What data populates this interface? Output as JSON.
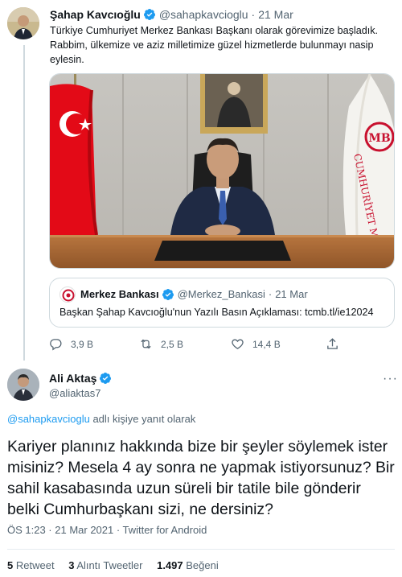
{
  "tweet1": {
    "author_name": "Şahap Kavcıoğlu",
    "handle": "@sahapkavcioglu",
    "separator": "·",
    "date": "21 Mar",
    "text_line1": "Türkiye Cumhuriyet Merkez Bankası Başkanı olarak görevimize başladık.",
    "text_line2": "Rabbim, ülkemize ve aziz milletimize güzel hizmetlerde bulunmayı nasip",
    "text_line3": "eylesin.",
    "photo_banner_text": "CUMHURİYET MERKEZ BANKASI",
    "photo_logo_text": "MB",
    "quote": {
      "author_name": "Merkez Bankası",
      "handle": "@Merkez_Bankasi",
      "separator": "·",
      "date": "21 Mar",
      "text": "Başkan Şahap Kavcıoğlu'nun Yazılı Basın Açıklaması: tcmb.tl/ie12024"
    },
    "actions": {
      "reply_count": "3,9 B",
      "retweet_count": "2,5 B",
      "like_count": "14,4 B"
    }
  },
  "tweet2": {
    "author_name": "Ali Aktaş",
    "handle": "@aliaktas7",
    "more_label": "···",
    "reply_to_handle": "@sahapkavcioglu",
    "reply_to_suffix": " adlı kişiye yanıt olarak",
    "text_line1": "Kariyer planınız hakkında bize bir şeyler söylemek ister",
    "text_line2": "misiniz? Mesela 4 ay sonra ne yapmak istiyorsunuz? Bir",
    "text_line3": "sahil kasabasında uzun süreli bir tatile bile gönderir",
    "text_line4": "belki Cumhurbaşkanı sizi, ne dersiniz?",
    "meta": "ÖS 1:23 · 21 Mar 2021 · Twitter for Android",
    "stats": {
      "retweets_count": "5",
      "retweets_label": "Retweet",
      "quotes_count": "3",
      "quotes_label": "Alıntı Tweetler",
      "likes_count": "1.497",
      "likes_label": "Beğeni"
    }
  },
  "colors": {
    "accent": "#1d9bf0",
    "muted": "#536471",
    "text": "#0f1419",
    "border": "#cfd9de",
    "flag_red": "#e30a17",
    "tcmb_red": "#c8102e"
  }
}
